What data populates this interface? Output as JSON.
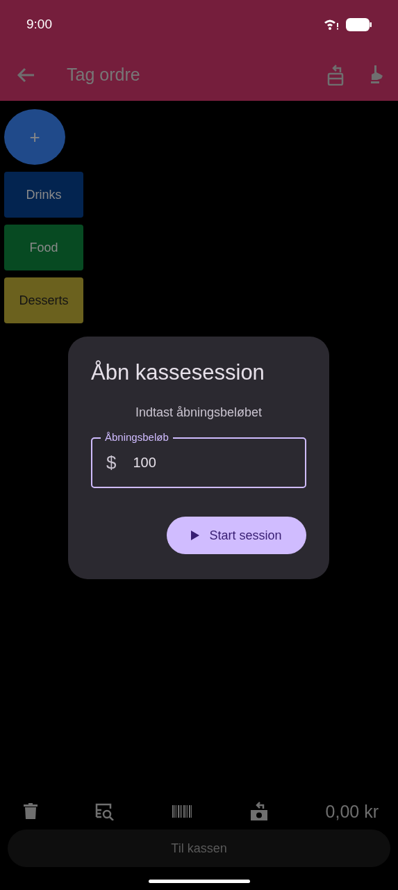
{
  "status_bar": {
    "time": "9:00"
  },
  "app_bar": {
    "title": "Tag ordre"
  },
  "add_button": {
    "label": "+"
  },
  "categories": [
    {
      "label": "Drinks",
      "color": "#032450"
    },
    {
      "label": "Food",
      "color": "#074a22"
    },
    {
      "label": "Desserts",
      "color": "#6b611e"
    }
  ],
  "dialog": {
    "title": "Åbn kassesession",
    "message": "Indtast åbningsbeløbet",
    "field": {
      "label": "Åbningsbeløb",
      "prefix": "$",
      "value": "100"
    },
    "button": "Start session"
  },
  "bottom_bar": {
    "total": "0,00 kr",
    "checkout_button": {
      "label": "Til kassen",
      "disabled": true
    }
  }
}
